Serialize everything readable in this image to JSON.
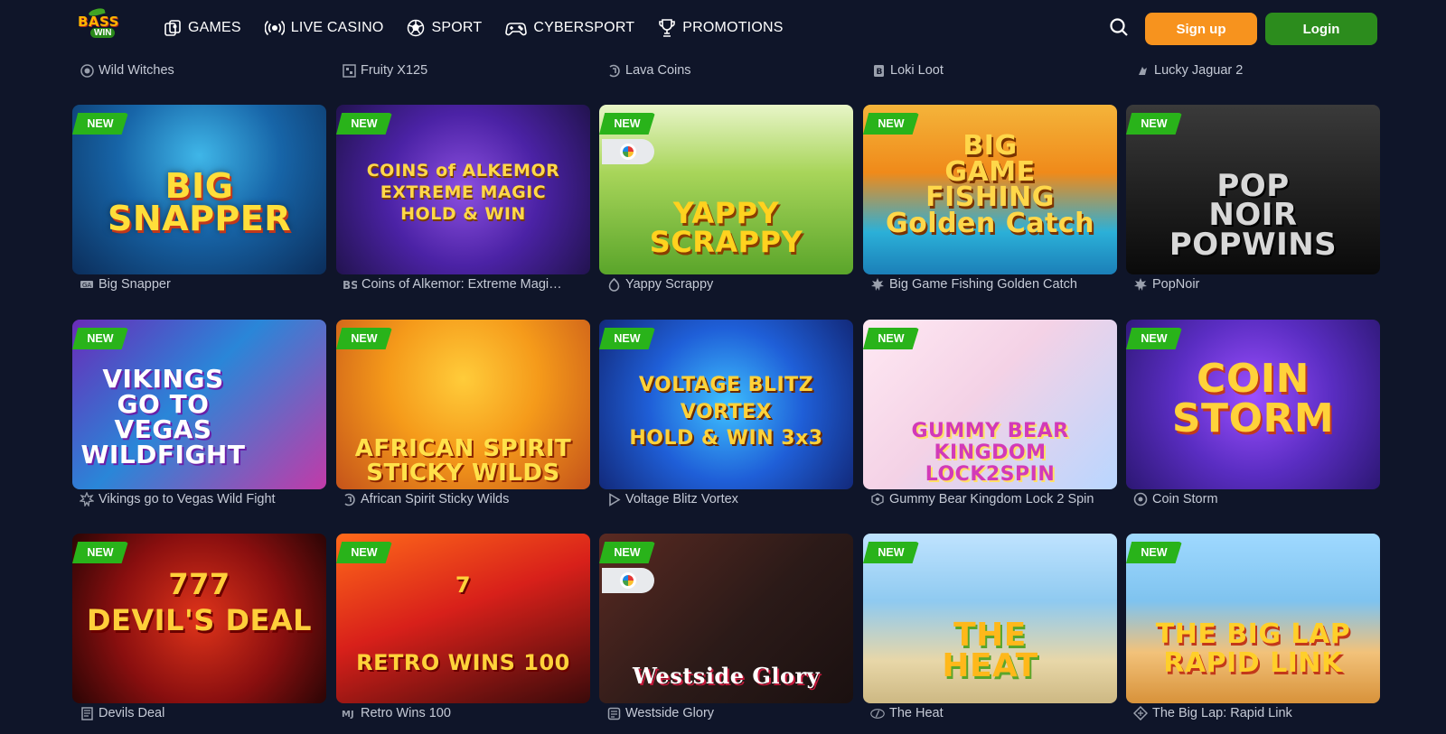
{
  "header": {
    "logo_top": "BASS",
    "logo_bottom": "WIN",
    "nav": [
      {
        "label": "GAMES",
        "icon": "games-icon"
      },
      {
        "label": "LIVE CASINO",
        "icon": "broadcast-icon"
      },
      {
        "label": "SPORT",
        "icon": "soccer-ball-icon"
      },
      {
        "label": "CYBERSPORT",
        "icon": "gamepad-icon"
      },
      {
        "label": "PROMOTIONS",
        "icon": "trophy-icon"
      }
    ],
    "signup_label": "Sign up",
    "login_label": "Login"
  },
  "colors": {
    "background": "#0f1529",
    "signup": "#f7931e",
    "login": "#2c8c1d",
    "badge_new": "#29b31a",
    "title_text": "#c5cad6"
  },
  "top_titles": [
    "Wild Witches",
    "Fruity X125",
    "Lava Coins",
    "Loki Loot",
    "Lucky Jaguar 2"
  ],
  "badge_new_label": "NEW",
  "games": [
    {
      "title": "Big Snapper",
      "art": "BIG\nSNAPPER",
      "chip": false
    },
    {
      "title": "Coins of Alkemor: Extreme Magi…",
      "art": "COINS of ALKEMOR\nEXTREME MAGIC\nHOLD & WIN",
      "chip": false
    },
    {
      "title": "Yappy Scrappy",
      "art": "YAPPY\nSCRAPPY",
      "chip": true
    },
    {
      "title": "Big Game Fishing Golden Catch",
      "art": "BIG\nGAME\nFISHING\nGolden Catch",
      "chip": false
    },
    {
      "title": "PopNoir",
      "art": "POP\nNOIR\nPOPWINS",
      "chip": false
    },
    {
      "title": "Vikings go to Vegas Wild Fight",
      "art": "VIKINGS\nGO TO\nVEGAS\nWILDFIGHT",
      "chip": false
    },
    {
      "title": "African Spirit Sticky Wilds",
      "art": "AFRICAN SPIRIT\nSTICKY WILDS",
      "chip": false
    },
    {
      "title": "Voltage Blitz Vortex",
      "art": "VOLTAGE BLITZ\nVORTEX\nHOLD & WIN 3x3",
      "chip": false
    },
    {
      "title": "Gummy Bear Kingdom Lock 2 Spin",
      "art": "GUMMY BEAR\nKINGDOM\nLOCK2SPIN",
      "chip": false
    },
    {
      "title": "Coin Storm",
      "art": "COIN\nSTORM",
      "chip": false
    },
    {
      "title": "Devils Deal",
      "art": "777\nDEVIL'S DEAL",
      "chip": false
    },
    {
      "title": "Retro Wins 100",
      "art": "7\nRETRO WINS 100",
      "chip": false
    },
    {
      "title": "Westside Glory",
      "art": "Westside Glory",
      "chip": true
    },
    {
      "title": "The Heat",
      "art": "THE\nHEAT",
      "chip": false
    },
    {
      "title": "The Big Lap: Rapid Link",
      "art": "THE BIG LAP\nRAPID LINK",
      "chip": false
    }
  ]
}
